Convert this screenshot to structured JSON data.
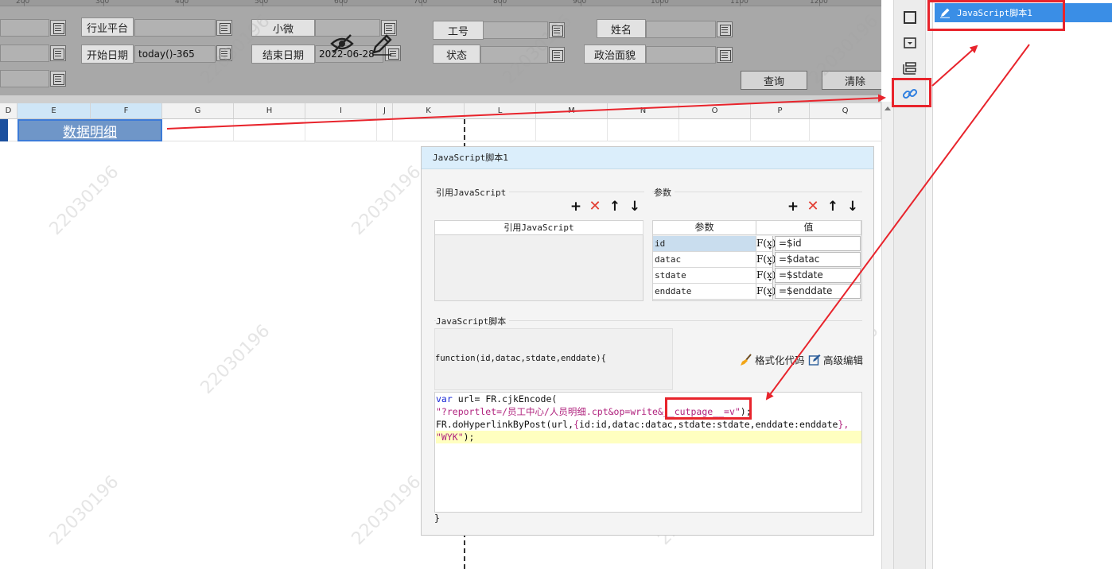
{
  "ruler": {
    "ticks": [
      "200",
      "300",
      "400",
      "500",
      "600",
      "700",
      "800",
      "900",
      "1000",
      "1100",
      "1200"
    ]
  },
  "params": {
    "industry_label": "行业平台",
    "small_label": "小微",
    "job_no_label": "工号",
    "name_label": "姓名",
    "start_date_label": "开始日期",
    "start_date_value": "today()-365",
    "end_date_label": "结束日期",
    "end_date_value": "2022-06-28",
    "status_label": "状态",
    "political_label": "政治面貌",
    "query_button": "查询",
    "clear_button": "清除"
  },
  "columns": [
    "D",
    "E",
    "F",
    "G",
    "H",
    "I",
    "J",
    "K",
    "L",
    "M",
    "N",
    "O",
    "P",
    "Q"
  ],
  "cell": {
    "text": "数据明细"
  },
  "watermark": "22030196",
  "dialog": {
    "title": "JavaScript脚本1",
    "ref_section": "引用JavaScript",
    "ref_header": "引用JavaScript",
    "param_section": "参数",
    "param_headers": {
      "name": "参数",
      "value": "值"
    },
    "params": [
      {
        "name": "id",
        "fx": "F(x)",
        "value": "=$id"
      },
      {
        "name": "datac",
        "fx": "F(x)",
        "value": "=$datac"
      },
      {
        "name": "stdate",
        "fx": "F(x)",
        "value": "=$stdate"
      },
      {
        "name": "enddate",
        "fx": "F(x)",
        "value": "=$enddate"
      }
    ],
    "script_section": "JavaScript脚本",
    "function_signature": "function(id,datac,stdate,enddate){",
    "format_code": "格式化代码",
    "advanced_edit": "高级编辑",
    "code": {
      "l1_kw": "var",
      "l1_rest": " url= FR.cjkEncode(",
      "l2_str": "\"?reportlet=/员工中心/人员明细.cpt&op=write&__cutpage__=v\"",
      "l2_rest": ");",
      "l3_a": "FR.doHyperlinkByPost(url,",
      "l3_b": "{",
      "l3_c": "id:id,datac:datac,stdate:stdate,enddate:enddate",
      "l3_d": "},",
      "l4_str": "\"WYK\"",
      "l4_rest": ");"
    },
    "closing_brace": "}"
  },
  "right_panel": {
    "item_label": "JavaScript脚本1"
  },
  "colors": {
    "accent": "#3a8ee6",
    "annotation": "#e8242c",
    "highlight": "#ffffc0"
  }
}
